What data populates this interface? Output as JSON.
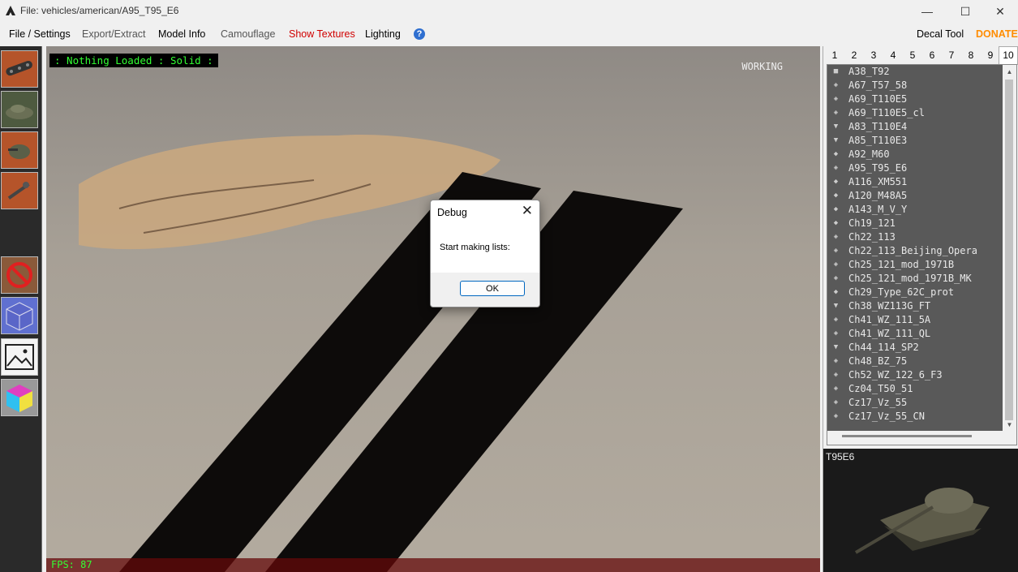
{
  "titlebar": {
    "title": "File: vehicles/american/A95_T95_E6",
    "min": "—",
    "max": "☐",
    "close": "✕"
  },
  "menu": {
    "file_settings": "File / Settings",
    "export_extract": "Export/Extract",
    "model_info": "Model Info",
    "camouflage": "Camouflage",
    "show_textures": "Show Textures",
    "lighting": "Lighting",
    "help": "?",
    "decal_tool": "Decal Tool",
    "donate": "DONATE"
  },
  "viewport": {
    "status": ": Nothing Loaded : Solid :",
    "working": "WORKING",
    "fps": "FPS: 87"
  },
  "dialog": {
    "title": "Debug",
    "close": "✕",
    "message": "Start making lists:",
    "ok": "OK"
  },
  "tabs": [
    "1",
    "2",
    "3",
    "4",
    "5",
    "6",
    "7",
    "8",
    "9",
    "10"
  ],
  "tanks": [
    "A38_T92",
    "A67_T57_58",
    "A69_T110E5",
    "A69_T110E5_cl",
    "A83_T110E4",
    "A85_T110E3",
    "A92_M60",
    "A95_T95_E6",
    "A116_XM551",
    "A120_M48A5",
    "A143_M_V_Y",
    "Ch19_121",
    "Ch22_113",
    "Ch22_113_Beijing_Opera",
    "Ch25_121_mod_1971B",
    "Ch25_121_mod_1971B_MK",
    "Ch29_Type_62C_prot",
    "Ch38_WZ113G_FT",
    "Ch41_WZ_111_5A",
    "Ch41_WZ_111_QL",
    "Ch44_114_SP2",
    "Ch48_BZ_75",
    "Ch52_WZ_122_6_F3",
    "Cz04_T50_51",
    "Cz17_Vz_55",
    "Cz17_Vz_55_CN"
  ],
  "preview": {
    "label": "T95E6"
  },
  "colors": {
    "accent_red": "#d00000",
    "donate_orange": "#ff8c00",
    "hud_green": "#33ff33"
  }
}
